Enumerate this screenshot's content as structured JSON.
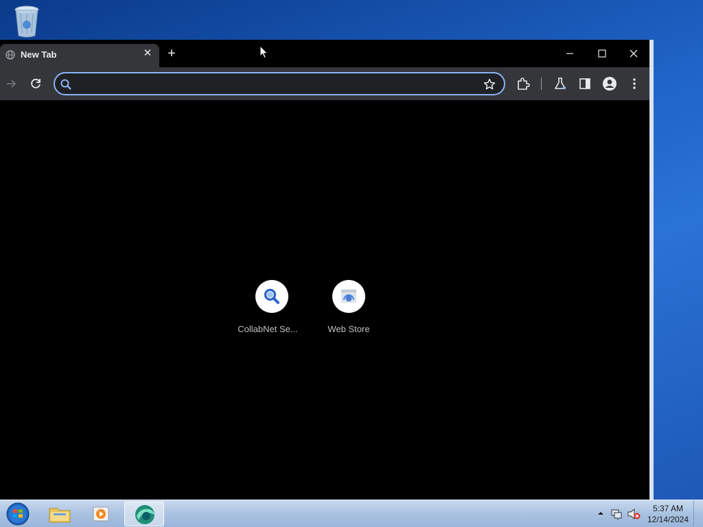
{
  "browser": {
    "tab": {
      "title": "New Tab",
      "close_glyph": "✕"
    },
    "new_tab_glyph": "+",
    "omnibox": {
      "value": "",
      "placeholder": ""
    },
    "shortcuts": [
      {
        "label": "CollabNet Se...",
        "icon": "search-icon"
      },
      {
        "label": "Web Store",
        "icon": "web-store-icon"
      }
    ],
    "accent_color": "#8ab4f8"
  },
  "taskbar": {
    "clock_time": "5:37 AM",
    "clock_date": "12/14/2024"
  }
}
